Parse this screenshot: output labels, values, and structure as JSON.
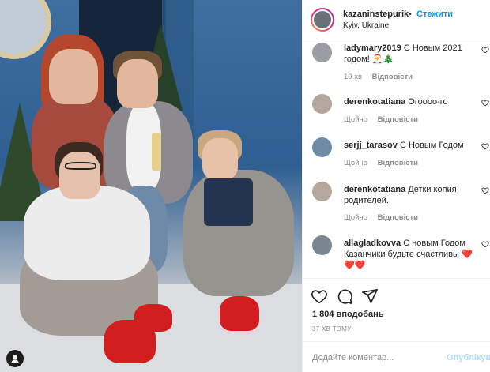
{
  "post": {
    "username": "kazaninstepurik",
    "separator": "•",
    "follow_label": "Стежити",
    "location": "Kyiv, Ukraine"
  },
  "comments": [
    {
      "username": "ladymary2019",
      "text": " С Новым 2021 годом!",
      "emoji": "🎅🎄",
      "meta": [
        "19 хв",
        "Відповісти"
      ]
    },
    {
      "username": "derenkotatiana",
      "text": " Огоооо-го",
      "meta": [
        "Щойно",
        "Відповісти"
      ]
    },
    {
      "username": "serjj_tarasov",
      "text": " С Новым Годом",
      "meta": [
        "Щойно",
        "Відповісти"
      ]
    },
    {
      "username": "derenkotatiana",
      "text": " Детки копия родителей.",
      "meta": [
        "Щойно",
        "Відповісти"
      ]
    },
    {
      "username": "allagladkovva",
      "text": " С новым Годом Казанчики будьте счастливы",
      "emoji": "❤️❤️❤️"
    }
  ],
  "actions": {
    "likes": "1 804 вподобань",
    "time_ago": "37 ХВ ТОМУ"
  },
  "composer": {
    "placeholder": "Додайте коментар...",
    "publish_label": "Опублікув"
  },
  "icons": {
    "like": "heart-icon",
    "comment": "comment-icon",
    "share": "send-icon",
    "photo_badge": "user-tag-icon",
    "comment_like": "heart-outline-icon"
  },
  "colors": {
    "accent": "#0095f6",
    "publish_disabled": "#b3dbff",
    "muted": "#8e8e8e",
    "heart_red": "#e0245e"
  }
}
